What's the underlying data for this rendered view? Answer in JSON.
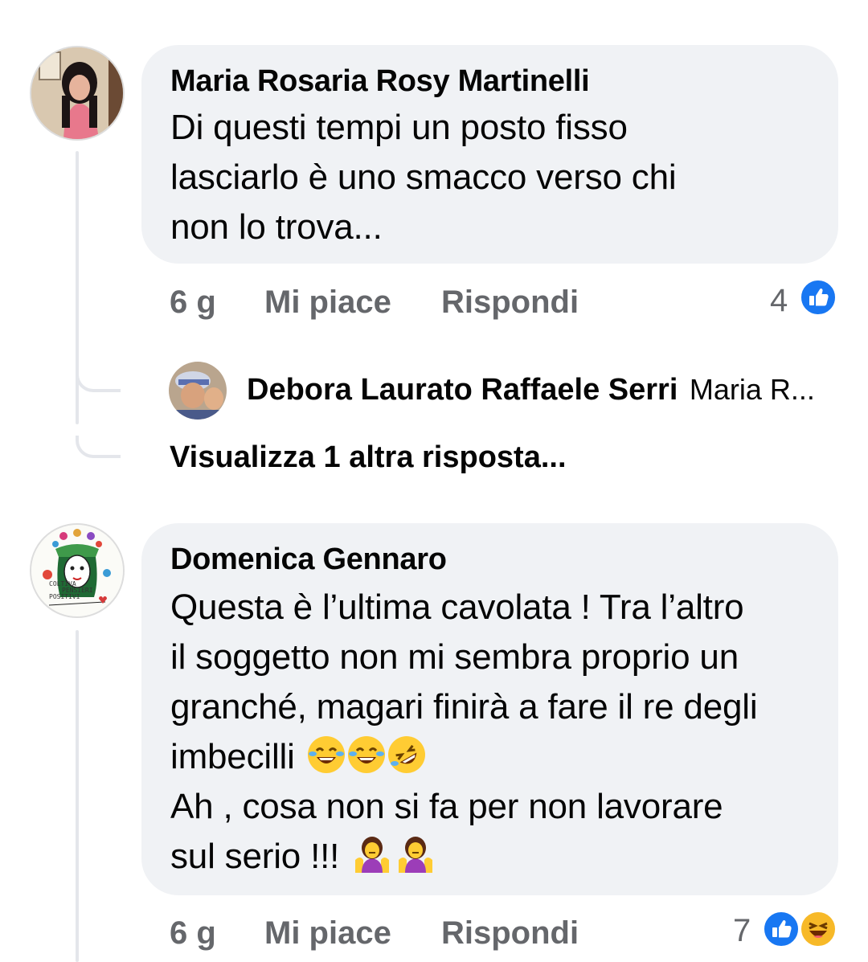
{
  "comments": [
    {
      "author": "Maria Rosaria Rosy Martinelli",
      "lines": [
        "Di questi tempi un posto fisso",
        "lasciarlo è  uno smacco verso chi",
        "non lo trova..."
      ],
      "time": "6 g",
      "like_label": "Mi piace",
      "reply_label": "Rispondi",
      "reaction_count": "4",
      "reactions": [
        "like-icon"
      ],
      "reply_preview": {
        "author": "Debora Laurato Raffaele Serri",
        "snippet": "Maria R..."
      },
      "more_replies": "Visualizza 1 altra risposta..."
    },
    {
      "author": "Domenica Gennaro",
      "lines": [
        "Questa è l’ultima cavolata ! Tra l’altro",
        "il soggetto non mi sembra proprio un",
        "granché, magari finirà a fare il re degli",
        "imbecilli",
        "Ah , cosa non si fa per non lavorare",
        "sul serio !!!"
      ],
      "time": "6 g",
      "like_label": "Mi piace",
      "reply_label": "Rispondi",
      "reaction_count": "7",
      "reactions": [
        "like-icon",
        "haha-icon"
      ],
      "avatar_text": [
        "COLTIVA",
        "PENSIERI",
        "POSITIVI"
      ]
    }
  ],
  "colors": {
    "bubble": "#f0f2f5",
    "meta": "#65676b",
    "like": "#1877f2",
    "haha": "#f7b928",
    "thread_line": "#e4e6eb"
  }
}
